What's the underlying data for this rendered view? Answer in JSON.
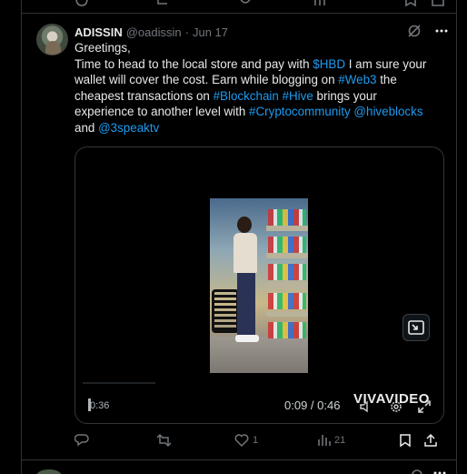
{
  "post": {
    "display_name": "ADISSIN",
    "handle": "@oadissin",
    "separator": "·",
    "date": "Jun 17",
    "text": {
      "line1": "Greetings,",
      "l2_a": "Time to head to the local store and pay with ",
      "l2_tag": "$HBD",
      "l2_b": " I am sure your",
      "l3_a": "wallet will cover the cost. Earn while blogging on ",
      "l3_tag": "#Web3",
      "l3_b": " the",
      "l4_a": "cheapest transactions on ",
      "l4_tag1": "#Blockchain",
      "l4_sp": " ",
      "l4_tag2": "#Hive",
      "l4_b": " brings your",
      "l5_a": "experience to another level with ",
      "l5_tag1": "#Cryptocommunity",
      "l5_sp": " ",
      "l5_tag2": "@hiveblocks",
      "l6_a": "and ",
      "l6_tag": "@3speaktv"
    }
  },
  "video": {
    "elapsed_overlay": "0:36",
    "timecode": "0:09 / 0:46",
    "watermark": "VIVAVIDEO"
  },
  "actions": {
    "reply_count": "",
    "retweet_count": "",
    "like_count": "1",
    "views_count": "21"
  },
  "colors": {
    "background": "#000000",
    "text": "#e7e9ea",
    "muted": "#71767b",
    "link": "#1d9bf0",
    "border": "#2f3336"
  },
  "icons": [
    "grok-icon",
    "more-icon",
    "pip-icon",
    "volume-icon",
    "settings-icon",
    "fullscreen-icon",
    "reply-icon",
    "retweet-icon",
    "like-icon",
    "views-icon",
    "bookmark-icon",
    "share-icon"
  ]
}
